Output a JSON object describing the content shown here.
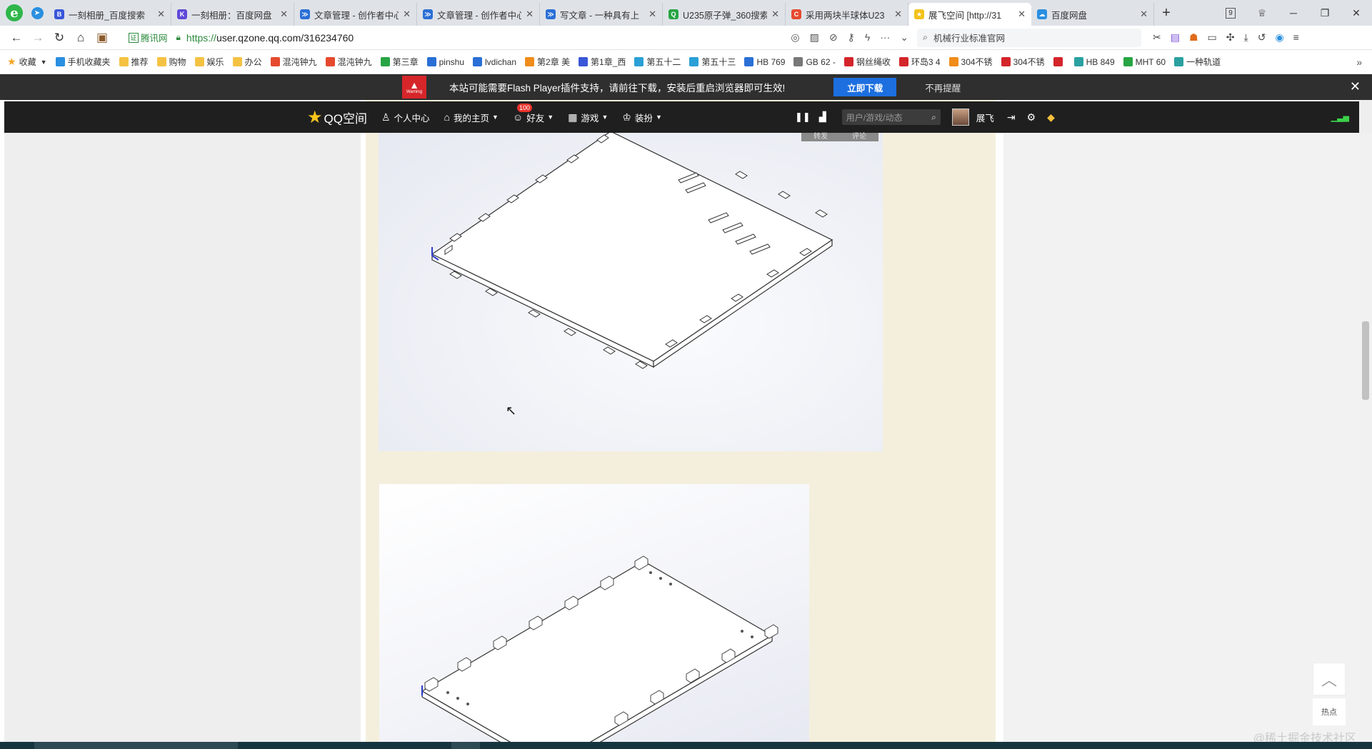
{
  "tabs": [
    {
      "title": "一刻相册_百度搜索",
      "color": "#3956d8",
      "glyph": "B"
    },
    {
      "title": "一刻相册：百度网盘",
      "color": "#6149d8",
      "glyph": "K"
    },
    {
      "title": "文章管理 - 创作者中心",
      "color": "#2a6fd6",
      "glyph": "≫"
    },
    {
      "title": "文章管理 - 创作者中心",
      "color": "#2a6fd6",
      "glyph": "≫"
    },
    {
      "title": "写文章 - 一种具有上",
      "color": "#2a6fd6",
      "glyph": "≫"
    },
    {
      "title": "U235原子弹_360搜索",
      "color": "#27a544",
      "glyph": "Q"
    },
    {
      "title": "采用两块半球体U23",
      "color": "#e64a2e",
      "glyph": "C"
    },
    {
      "title": "展飞空间 [http://31",
      "color": "#f3c21a",
      "glyph": "★",
      "active": true
    },
    {
      "title": "百度网盘",
      "color": "#2a8fe0",
      "glyph": "☁"
    }
  ],
  "window": {
    "tab_count": "9"
  },
  "addressbar": {
    "cert": "腾讯网",
    "url_scheme": "https://",
    "url_rest": "user.qzone.qq.com/316234760",
    "search_text": "机械行业标准官网"
  },
  "bookmarks": [
    {
      "label": "收藏",
      "kind": "star"
    },
    {
      "label": "手机收藏夹",
      "color": "#2a8fe0"
    },
    {
      "label": "推荐",
      "kind": "folder"
    },
    {
      "label": "购物",
      "kind": "folder"
    },
    {
      "label": "娱乐",
      "kind": "folder"
    },
    {
      "label": "办公",
      "kind": "folder"
    },
    {
      "label": "混沌钟九",
      "color": "#e64a2e"
    },
    {
      "label": "混沌钟九",
      "color": "#e64a2e"
    },
    {
      "label": "第三章",
      "color": "#27a544"
    },
    {
      "label": "pinshu",
      "color": "#2a6fd6"
    },
    {
      "label": "lvdichan",
      "color": "#2a6fd6"
    },
    {
      "label": "第2章 美",
      "color": "#f08c1a"
    },
    {
      "label": "第1章_西",
      "color": "#3956d8"
    },
    {
      "label": "第五十二",
      "color": "#2aa0d6"
    },
    {
      "label": "第五十三",
      "color": "#2aa0d6"
    },
    {
      "label": "HB 769",
      "color": "#2a6fd6"
    },
    {
      "label": "GB 62 -",
      "color": "#777777"
    },
    {
      "label": "钢丝绳收",
      "color": "#d3252a"
    },
    {
      "label": "环岛3 4",
      "color": "#d3252a"
    },
    {
      "label": "304不锈",
      "color": "#f08c1a"
    },
    {
      "label": "304不锈",
      "color": "#d3252a"
    },
    {
      "label": "",
      "color": "#d3252a"
    },
    {
      "label": "HB 849",
      "color": "#2aa0a0"
    },
    {
      "label": "MHT 60",
      "color": "#27a544"
    },
    {
      "label": "一种轨道",
      "color": "#2aa0a0"
    }
  ],
  "flash": {
    "warning_label": "Warning",
    "message": "本站可能需要Flash Player插件支持，请前往下载，安装后重启浏览器即可生效!",
    "download_button": "立即下载",
    "dismiss": "不再提醒"
  },
  "qzone_nav": {
    "logo": "QQ空间",
    "items": [
      {
        "label": "个人中心",
        "icon": "person-icon",
        "glyph": "♙",
        "caret": false
      },
      {
        "label": "我的主页",
        "icon": "home-icon",
        "glyph": "⌂",
        "caret": true
      },
      {
        "label": "好友",
        "icon": "friends-icon",
        "glyph": "☺",
        "caret": true,
        "badge": "100"
      },
      {
        "label": "游戏",
        "icon": "grid-icon",
        "glyph": "▦",
        "caret": true
      },
      {
        "label": "装扮",
        "icon": "shirt-icon",
        "glyph": "♔",
        "caret": true
      }
    ],
    "search_placeholder": "用户/游戏/动态",
    "username": "展飞"
  },
  "post": {
    "share_label": "转发",
    "comment_label": "评论"
  },
  "page": {
    "hot_label": "热点",
    "watermark": "@稀土掘金技术社区"
  }
}
